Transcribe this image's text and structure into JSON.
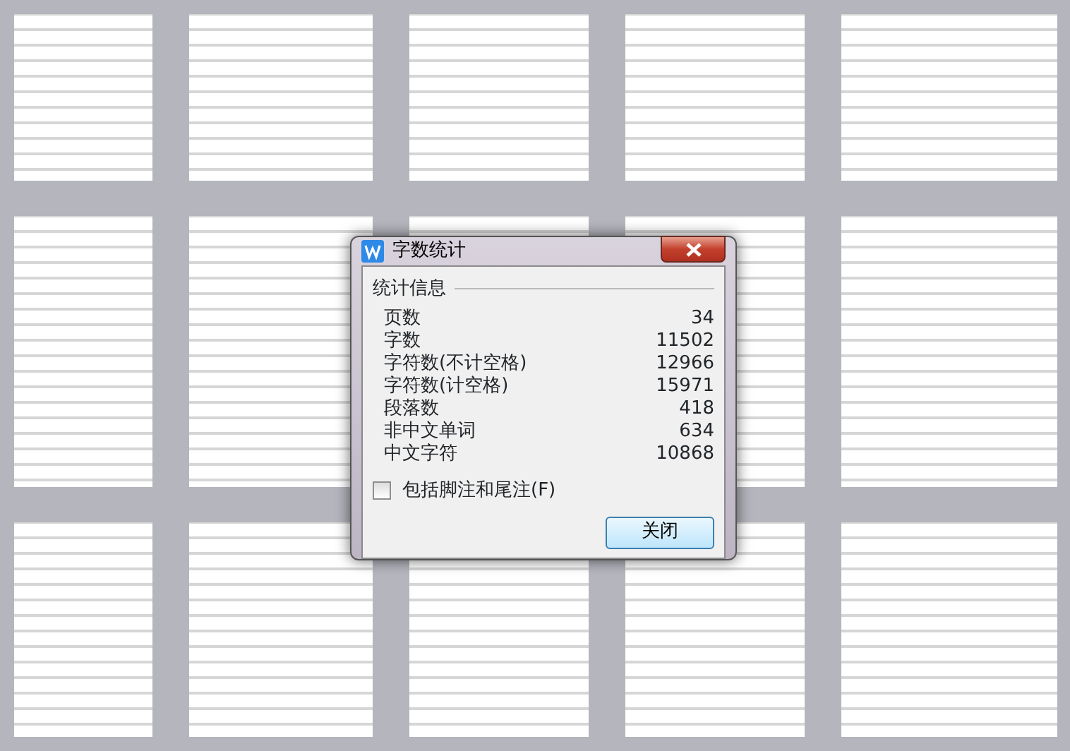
{
  "dialog": {
    "title": "字数统计",
    "group_title": "统计信息",
    "stats": [
      {
        "label": "页数",
        "value": "34"
      },
      {
        "label": "字数",
        "value": "11502"
      },
      {
        "label": "字符数(不计空格)",
        "value": "12966"
      },
      {
        "label": "字符数(计空格)",
        "value": "15971"
      },
      {
        "label": "段落数",
        "value": "418"
      },
      {
        "label": "非中文单词",
        "value": "634"
      },
      {
        "label": "中文字符",
        "value": "10868"
      }
    ],
    "checkbox": {
      "label": "包括脚注和尾注(F)",
      "checked": false
    },
    "buttons": [
      {
        "label": "关闭"
      }
    ]
  }
}
